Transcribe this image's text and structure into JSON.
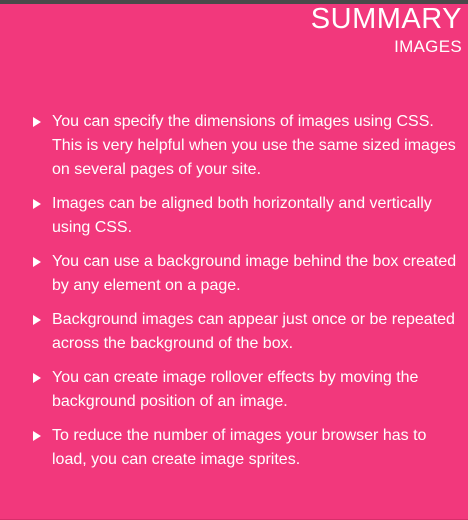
{
  "header": {
    "title": "SUMMARY",
    "subtitle": "IMAGES"
  },
  "bullets": [
    "You can specify the dimensions of images using CSS. This is very helpful when you use the same sized images on several pages of your site.",
    "Images can be aligned both horizontally and vertically using CSS.",
    "You can use a background image behind the box created by any element on a page.",
    "Background images can appear just once or be repeated across the background of the box.",
    "You can create image rollover effects by moving the background position of an image.",
    "To reduce the number of images your browser has to load, you can create image sprites."
  ],
  "colors": {
    "background": "#f2387c",
    "text": "#ffffff",
    "top_bar": "#4a4a4a"
  },
  "icons": {
    "bullet": "triangle-right-icon"
  }
}
